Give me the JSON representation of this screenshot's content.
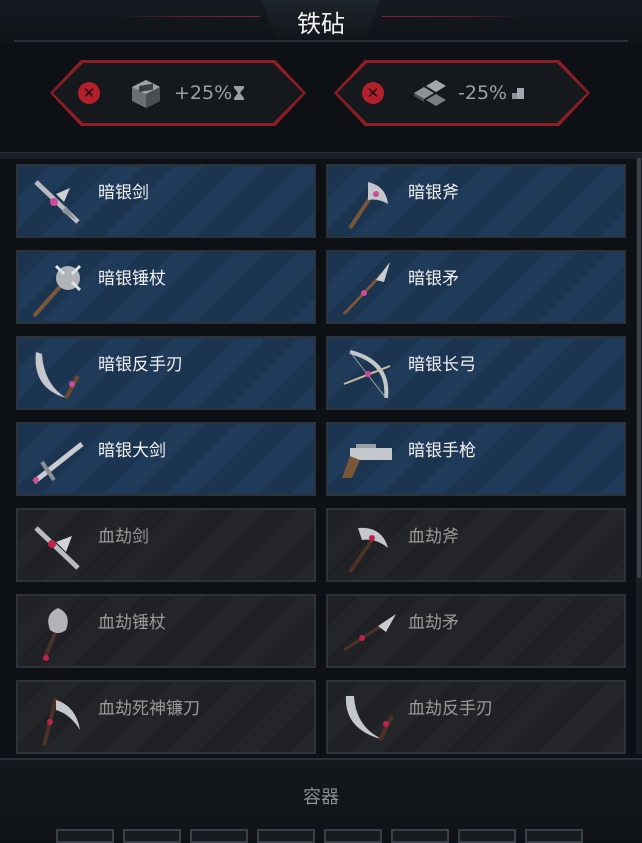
{
  "window": {
    "title": "铁砧"
  },
  "modifiers": [
    {
      "value": "+25%",
      "resource_icon": "stone-block-icon",
      "suffix_icon": "hourglass-icon"
    },
    {
      "value": "-25%",
      "resource_icon": "stone-tiles-icon",
      "suffix_icon": "coin-stack-icon"
    }
  ],
  "weapons": [
    {
      "name": "暗银剑",
      "icon": "sword-icon",
      "state": "available"
    },
    {
      "name": "暗银斧",
      "icon": "axe-icon",
      "state": "available"
    },
    {
      "name": "暗银锤杖",
      "icon": "mace-icon",
      "state": "available"
    },
    {
      "name": "暗银矛",
      "icon": "spear-icon",
      "state": "available"
    },
    {
      "name": "暗银反手刃",
      "icon": "reverse-blade-icon",
      "state": "available"
    },
    {
      "name": "暗银长弓",
      "icon": "longbow-icon",
      "state": "available"
    },
    {
      "name": "暗银大剑",
      "icon": "greatsword-icon",
      "state": "available"
    },
    {
      "name": "暗银手枪",
      "icon": "pistol-icon",
      "state": "available"
    },
    {
      "name": "血劫剑",
      "icon": "sword-icon",
      "state": "locked"
    },
    {
      "name": "血劫斧",
      "icon": "axe-icon",
      "state": "locked"
    },
    {
      "name": "血劫锤杖",
      "icon": "mace-icon",
      "state": "locked"
    },
    {
      "name": "血劫矛",
      "icon": "spear-icon",
      "state": "locked"
    },
    {
      "name": "血劫死神镰刀",
      "icon": "scythe-icon",
      "state": "locked"
    },
    {
      "name": "血劫反手刃",
      "icon": "reverse-blade-icon",
      "state": "locked"
    }
  ],
  "footer": {
    "container_label": "容器"
  },
  "colors": {
    "accent_red": "#8e1d25",
    "available_bg": "#1b3450",
    "locked_bg": "#1f2124"
  }
}
